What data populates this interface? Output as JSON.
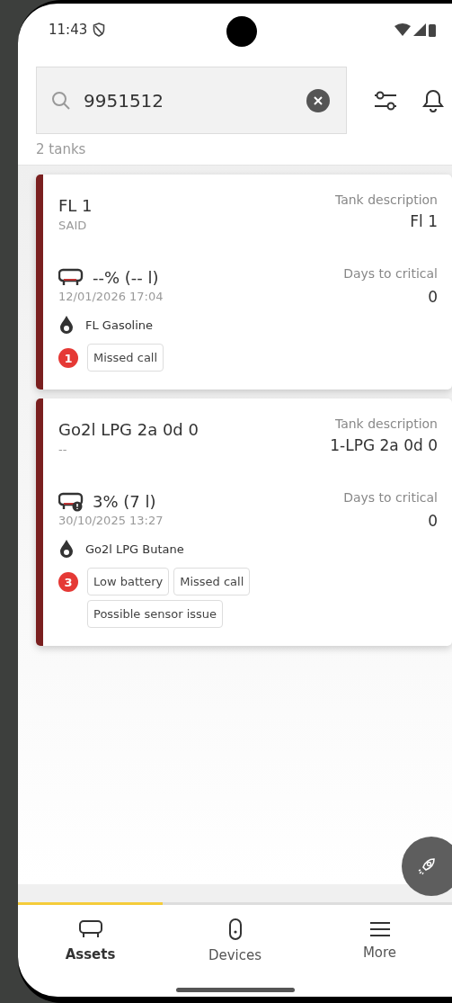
{
  "status_bar": {
    "time": "11:43"
  },
  "search": {
    "value": "9951512"
  },
  "result_count": "2 tanks",
  "tanks": [
    {
      "name": "FL 1",
      "subtitle": "SAID",
      "description_label": "Tank description",
      "description": "Fl 1",
      "level_text": "--% (-- l)",
      "warning": false,
      "timestamp": "12/01/2026 17:04",
      "critical_label": "Days to critical",
      "critical_days": "0",
      "product": "FL Gasoline",
      "alert_count": "1",
      "alerts": [
        "Missed call"
      ]
    },
    {
      "name": "Go2l LPG 2a 0d 0",
      "subtitle": "--",
      "description_label": "Tank description",
      "description": "1-LPG 2a 0d 0",
      "level_text": "3% (7 l)",
      "warning": true,
      "timestamp": "30/10/2025 13:27",
      "critical_label": "Days to critical",
      "critical_days": "0",
      "product": "Go2l LPG Butane",
      "alert_count": "3",
      "alerts": [
        "Low battery",
        "Missed call",
        "Possible sensor issue"
      ]
    }
  ],
  "nav": [
    {
      "label": "Assets",
      "kind": "tank",
      "selected": true
    },
    {
      "label": "Devices",
      "kind": "device",
      "selected": false
    },
    {
      "label": "More",
      "kind": "menu",
      "selected": false
    }
  ]
}
